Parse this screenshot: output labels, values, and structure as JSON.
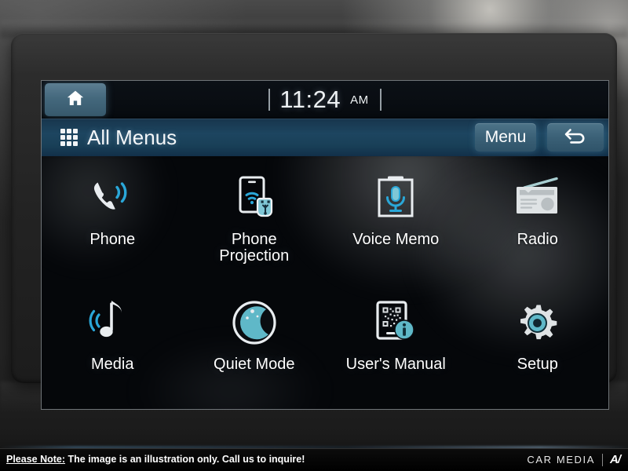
{
  "statusbar": {
    "home_icon": "home-icon",
    "clock_time": "11:24",
    "clock_ampm": "AM"
  },
  "titlebar": {
    "grid_icon": "grid-menu-icon",
    "title": "All Menus",
    "menu_label": "Menu",
    "back_icon": "back-arrow-icon"
  },
  "apps": [
    {
      "label": "Phone",
      "icon": "phone-handset-icon"
    },
    {
      "label": "Phone\nProjection",
      "icon": "phone-projection-icon"
    },
    {
      "label": "Voice Memo",
      "icon": "voice-memo-icon"
    },
    {
      "label": "Radio",
      "icon": "radio-icon"
    },
    {
      "label": "Media",
      "icon": "music-note-icon"
    },
    {
      "label": "Quiet Mode",
      "icon": "moon-quiet-mode-icon"
    },
    {
      "label": "User's Manual",
      "icon": "users-manual-qr-icon"
    },
    {
      "label": "Setup",
      "icon": "gear-icon"
    }
  ],
  "footer": {
    "note_prefix": "Please Note:",
    "note_text": " The image is an illustration only. Call us to inquire!",
    "brand_text": "CAR MEDIA",
    "brand_mark": "A/"
  },
  "colors": {
    "accent_teal": "#5fc2d4",
    "accent_blue": "#2aa7d8",
    "titlebar_blue": "#1d4560",
    "icon_white": "#e9edf0",
    "screen_black": "#05070a"
  }
}
